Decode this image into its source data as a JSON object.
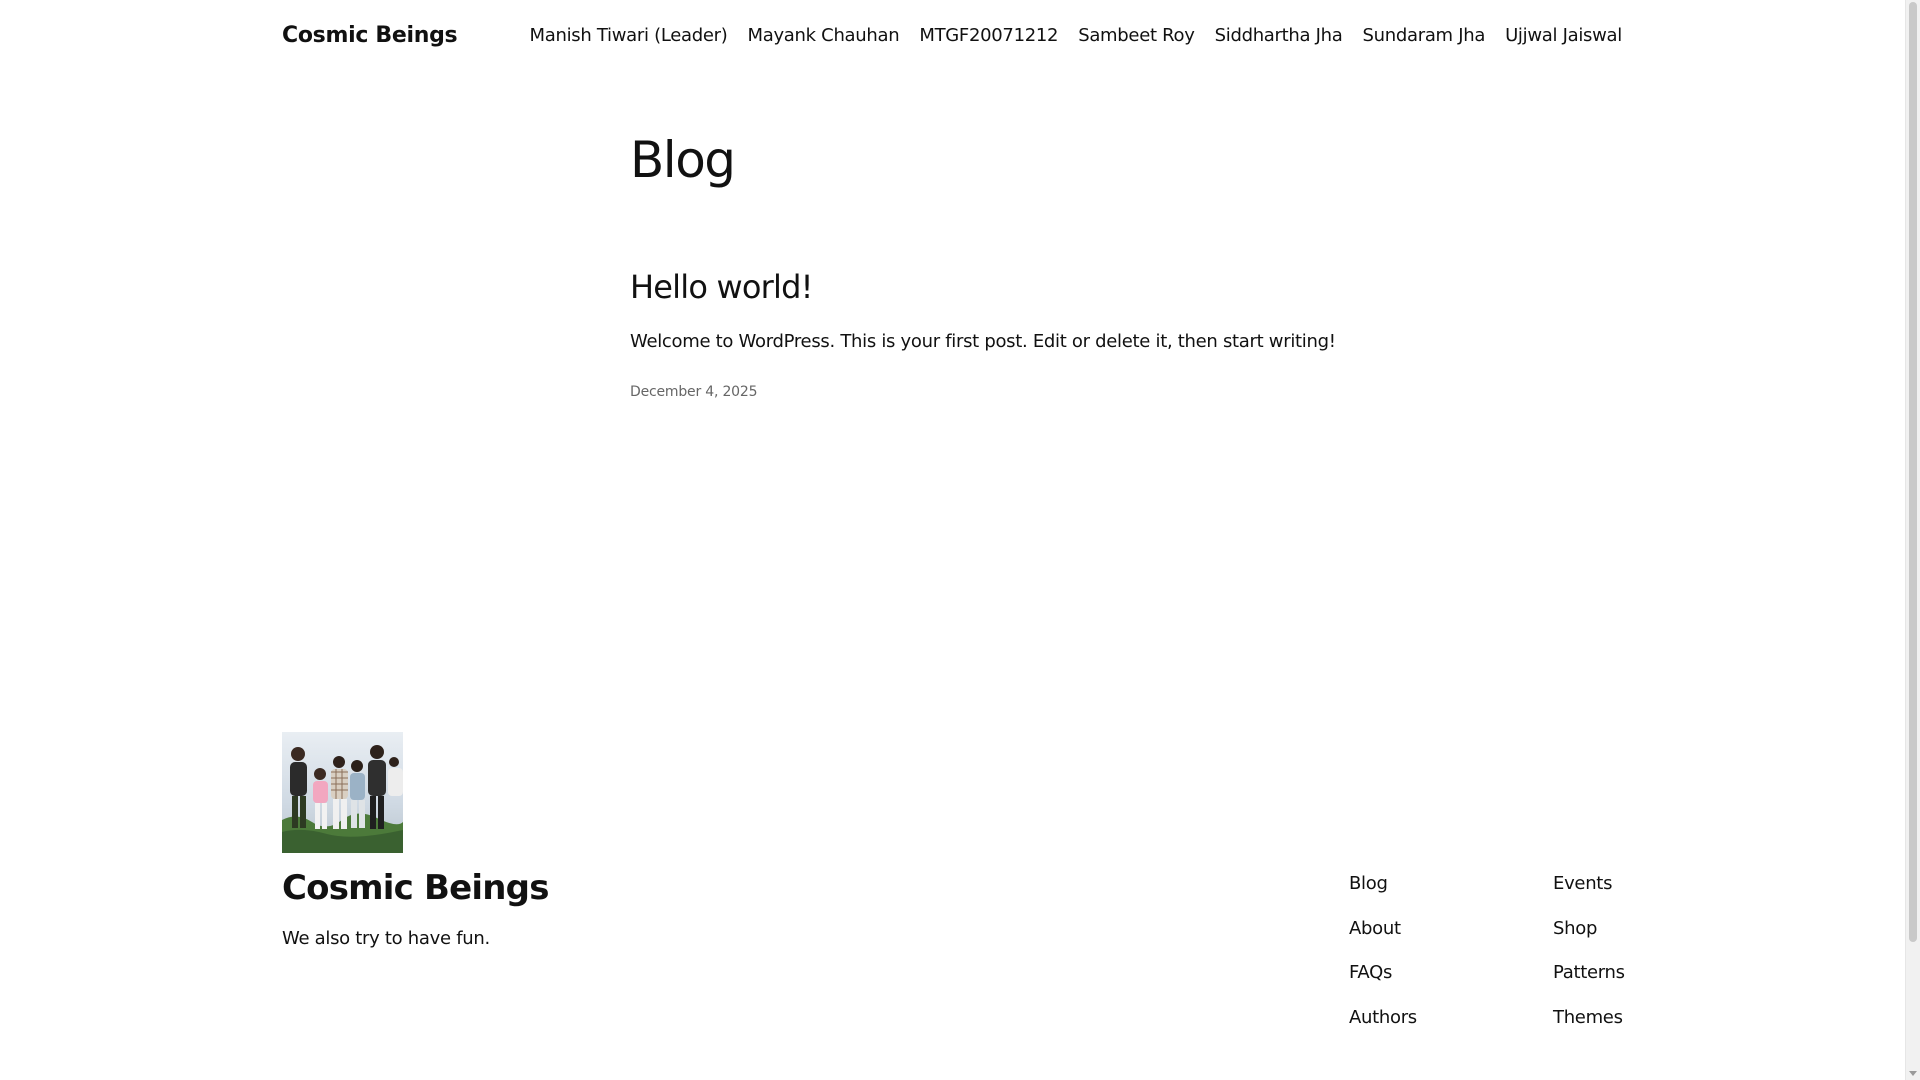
{
  "header": {
    "site_title": "Cosmic Beings",
    "nav": [
      {
        "label": "Manish Tiwari (Leader)"
      },
      {
        "label": "Mayank Chauhan"
      },
      {
        "label": "MTGF20071212"
      },
      {
        "label": "Sambeet Roy"
      },
      {
        "label": "Siddhartha Jha"
      },
      {
        "label": "Sundaram Jha"
      },
      {
        "label": "Ujjwal Jaiswal"
      }
    ]
  },
  "main": {
    "page_title": "Blog",
    "posts": [
      {
        "title": "Hello world!",
        "excerpt": "Welcome to WordPress. This is your first post. Edit or delete it, then start writing!",
        "date": "December 4, 2025"
      }
    ]
  },
  "footer": {
    "site_title": "Cosmic Beings",
    "tagline": "We also try to have fun.",
    "links_col_1": [
      {
        "label": "Blog"
      },
      {
        "label": "About"
      },
      {
        "label": "FAQs"
      },
      {
        "label": "Authors"
      }
    ],
    "links_col_2": [
      {
        "label": "Events"
      },
      {
        "label": "Shop"
      },
      {
        "label": "Patterns"
      },
      {
        "label": "Themes"
      }
    ]
  }
}
